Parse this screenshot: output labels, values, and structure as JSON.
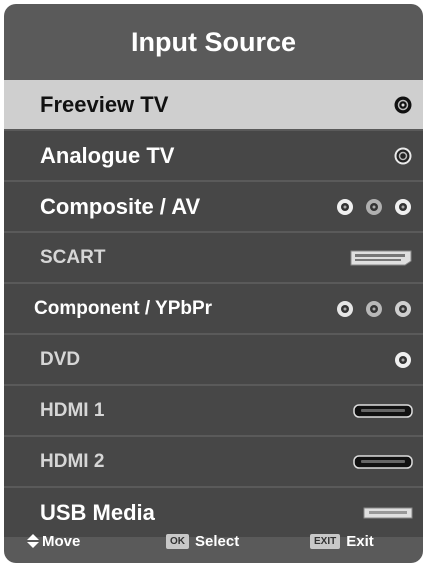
{
  "menu": {
    "title": "Input Source",
    "items": [
      {
        "label": "Freeview TV",
        "icon": "coax-connector-icon",
        "selected": true
      },
      {
        "label": "Analogue TV",
        "icon": "coax-connector-icon",
        "selected": false
      },
      {
        "label": "Composite / AV",
        "icon": "rca-triple-connector-icon",
        "selected": false
      },
      {
        "label": "SCART",
        "icon": "scart-connector-icon",
        "selected": false
      },
      {
        "label": "Component / YPbPr",
        "icon": "rca-triple-connector-icon",
        "selected": false
      },
      {
        "label": "DVD",
        "icon": "dvd-rca-connector-icon",
        "selected": false
      },
      {
        "label": "HDMI 1",
        "icon": "hdmi-connector-icon",
        "selected": false
      },
      {
        "label": "HDMI 2",
        "icon": "hdmi-connector-icon",
        "selected": false
      },
      {
        "label": "USB Media",
        "icon": "usb-connector-icon",
        "selected": false
      }
    ]
  },
  "footer": {
    "move_label": "Move",
    "ok_key": "OK",
    "select_label": "Select",
    "exit_key": "EXIT",
    "exit_label": "Exit"
  },
  "colors": {
    "panel": "#5a5a5a",
    "row": "#474747",
    "selected_row": "#cfcfcf",
    "text": "#ffffff",
    "selected_text": "#111111"
  }
}
